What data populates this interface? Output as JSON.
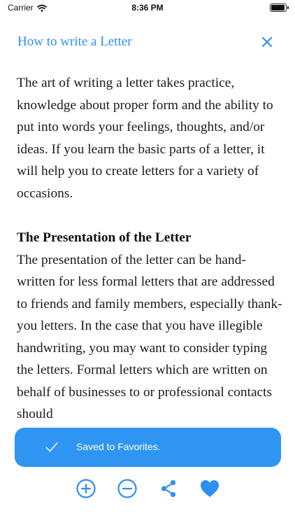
{
  "status_bar": {
    "carrier": "Carrier",
    "time": "8:36 PM"
  },
  "nav": {
    "title": "How to write a Letter"
  },
  "article": {
    "intro": "The art of writing a letter takes practice, knowledge about proper form and the ability to put into words your feelings, thoughts, and/or ideas. If you learn the basic parts of a letter, it will help you to create letters for a variety of occasions.",
    "section_heading": "The Presentation of the Letter",
    "section_body": "The presentation of the letter can be hand-written for less formal letters that are addressed to friends and family members, especially thank-you letters. In the case that you have illegible handwriting, you may want to consider typing the letters. Formal letters which are written on behalf of businesses to or professional contacts should"
  },
  "toast": {
    "message": "Saved to Favorites."
  },
  "toolbar": {
    "icons": [
      "zoom-in-icon",
      "zoom-out-icon",
      "share-icon",
      "heart-icon"
    ]
  },
  "colors": {
    "accent": "#2f8ff0",
    "toast_bg": "#2f95f2"
  },
  "battery_level": 0.95
}
